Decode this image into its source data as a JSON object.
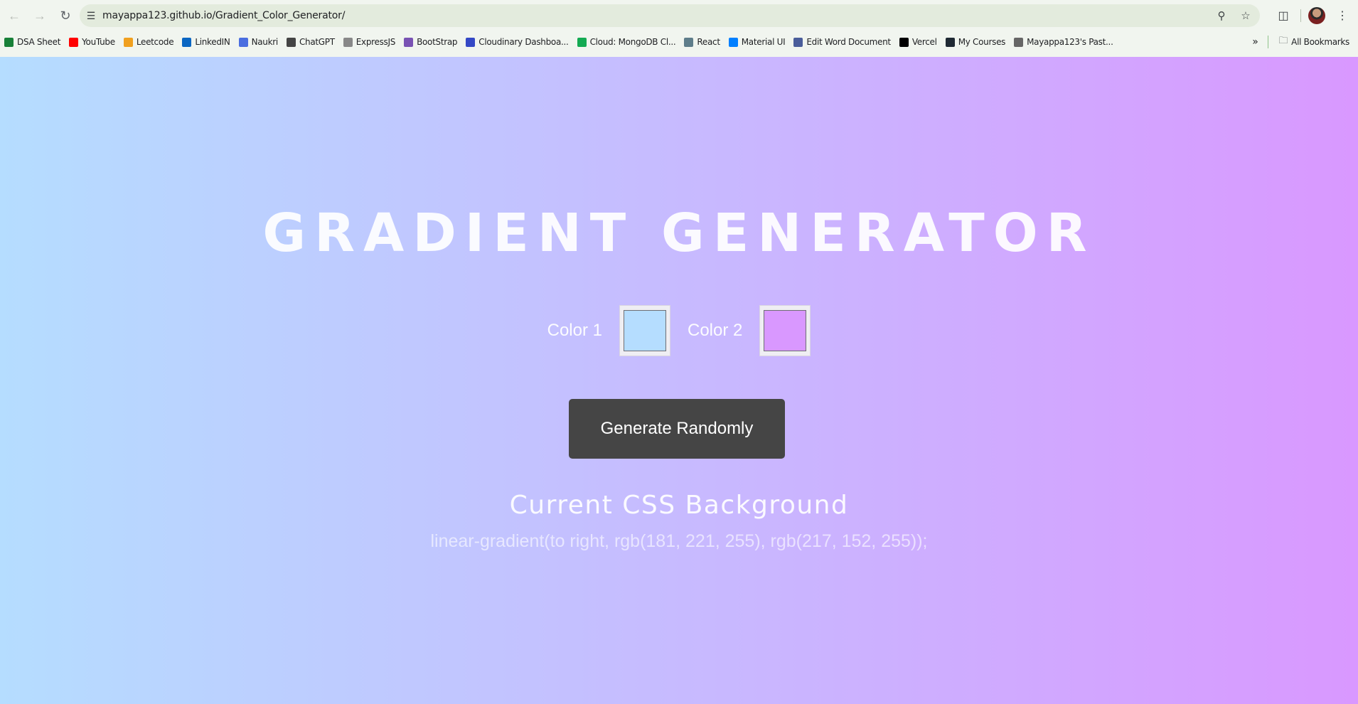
{
  "browser": {
    "url": "mayappa123.github.io/Gradient_Color_Generator/",
    "bookmarks": [
      {
        "label": "DSA Sheet",
        "icon": "sheets-icon",
        "color": "#188038"
      },
      {
        "label": "YouTube",
        "icon": "youtube-icon",
        "color": "#ff0000"
      },
      {
        "label": "Leetcode",
        "icon": "leetcode-icon",
        "color": "#f0a01f"
      },
      {
        "label": "LinkedIN",
        "icon": "linkedin-icon",
        "color": "#0a66c2"
      },
      {
        "label": "Naukri",
        "icon": "naukri-icon",
        "color": "#4a6ee0"
      },
      {
        "label": "ChatGPT",
        "icon": "chatgpt-icon",
        "color": "#444444"
      },
      {
        "label": "ExpressJS",
        "icon": "express-icon",
        "color": "#888888"
      },
      {
        "label": "BootStrap",
        "icon": "bootstrap-icon",
        "color": "#7952b3"
      },
      {
        "label": "Cloudinary Dashboa...",
        "icon": "cloudinary-icon",
        "color": "#3448c5"
      },
      {
        "label": "Cloud: MongoDB Cl...",
        "icon": "mongodb-icon",
        "color": "#13aa52"
      },
      {
        "label": "React",
        "icon": "react-icon",
        "color": "#5e7d8a"
      },
      {
        "label": "Material UI",
        "icon": "mui-icon",
        "color": "#007fff"
      },
      {
        "label": "Edit Word Document",
        "icon": "word-icon",
        "color": "#4a5d9a"
      },
      {
        "label": "Vercel",
        "icon": "vercel-icon",
        "color": "#000000"
      },
      {
        "label": "My Courses",
        "icon": "courses-icon",
        "color": "#1f2933"
      },
      {
        "label": "Mayappa123's Past...",
        "icon": "past-icon",
        "color": "#666666"
      }
    ],
    "all_bookmarks_label": "All Bookmarks"
  },
  "page": {
    "title": "GRADIENT GENERATOR",
    "color1_label": "Color 1",
    "color2_label": "Color 2",
    "color1_value": "#b5ddff",
    "color2_value": "#d998ff",
    "generate_label": "Generate Randomly",
    "css_heading": "Current CSS Background",
    "css_value": "linear-gradient(to right, rgb(181, 221, 255), rgb(217, 152, 255));"
  }
}
